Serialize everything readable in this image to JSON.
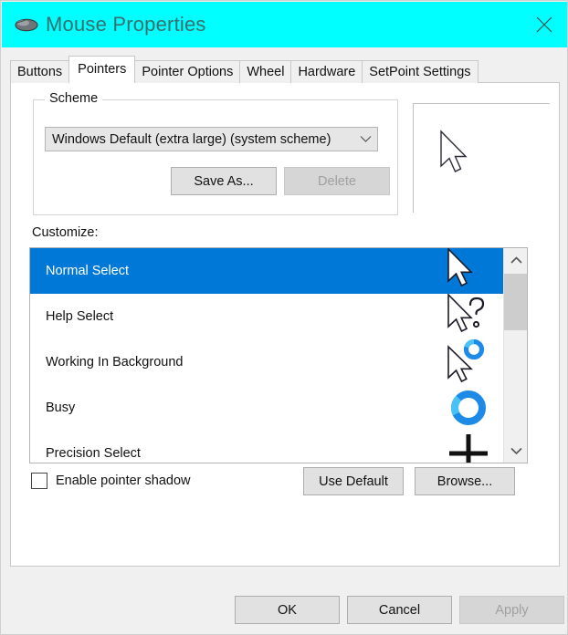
{
  "window": {
    "title": "Mouse Properties",
    "icon": "mouse-icon",
    "close_icon": "close-icon",
    "titlebar_color": "#00ffff",
    "title_text_color": "#3b6f6f"
  },
  "tabs": [
    {
      "label": "Buttons",
      "active": false
    },
    {
      "label": "Pointers",
      "active": true
    },
    {
      "label": "Pointer Options",
      "active": false
    },
    {
      "label": "Wheel",
      "active": false
    },
    {
      "label": "Hardware",
      "active": false
    },
    {
      "label": "SetPoint Settings",
      "active": false
    }
  ],
  "scheme": {
    "legend": "Scheme",
    "selected": "Windows Default (extra large) (system scheme)",
    "dropdown_icon": "chevron-down-icon",
    "save_as_label": "Save As...",
    "delete_label": "Delete",
    "delete_enabled": false
  },
  "preview": {
    "cursor_icon": "arrow-cursor-icon"
  },
  "customize": {
    "label": "Customize:",
    "selection_color": "#0078d7",
    "items": [
      {
        "label": "Normal Select",
        "icon": "arrow-cursor-icon",
        "selected": true
      },
      {
        "label": "Help Select",
        "icon": "arrow-question-cursor-icon",
        "selected": false
      },
      {
        "label": "Working In Background",
        "icon": "arrow-busy-ring-cursor-icon",
        "selected": false
      },
      {
        "label": "Busy",
        "icon": "busy-ring-icon",
        "selected": false
      },
      {
        "label": "Precision Select",
        "icon": "crosshair-icon",
        "selected": false
      }
    ],
    "scrollbar": {
      "up_icon": "chevron-up-icon",
      "down_icon": "chevron-down-icon"
    }
  },
  "options": {
    "shadow_label": "Enable pointer shadow",
    "shadow_checked": false,
    "use_default_label": "Use Default",
    "browse_label": "Browse..."
  },
  "footer": {
    "ok_label": "OK",
    "cancel_label": "Cancel",
    "apply_label": "Apply",
    "apply_enabled": false
  }
}
